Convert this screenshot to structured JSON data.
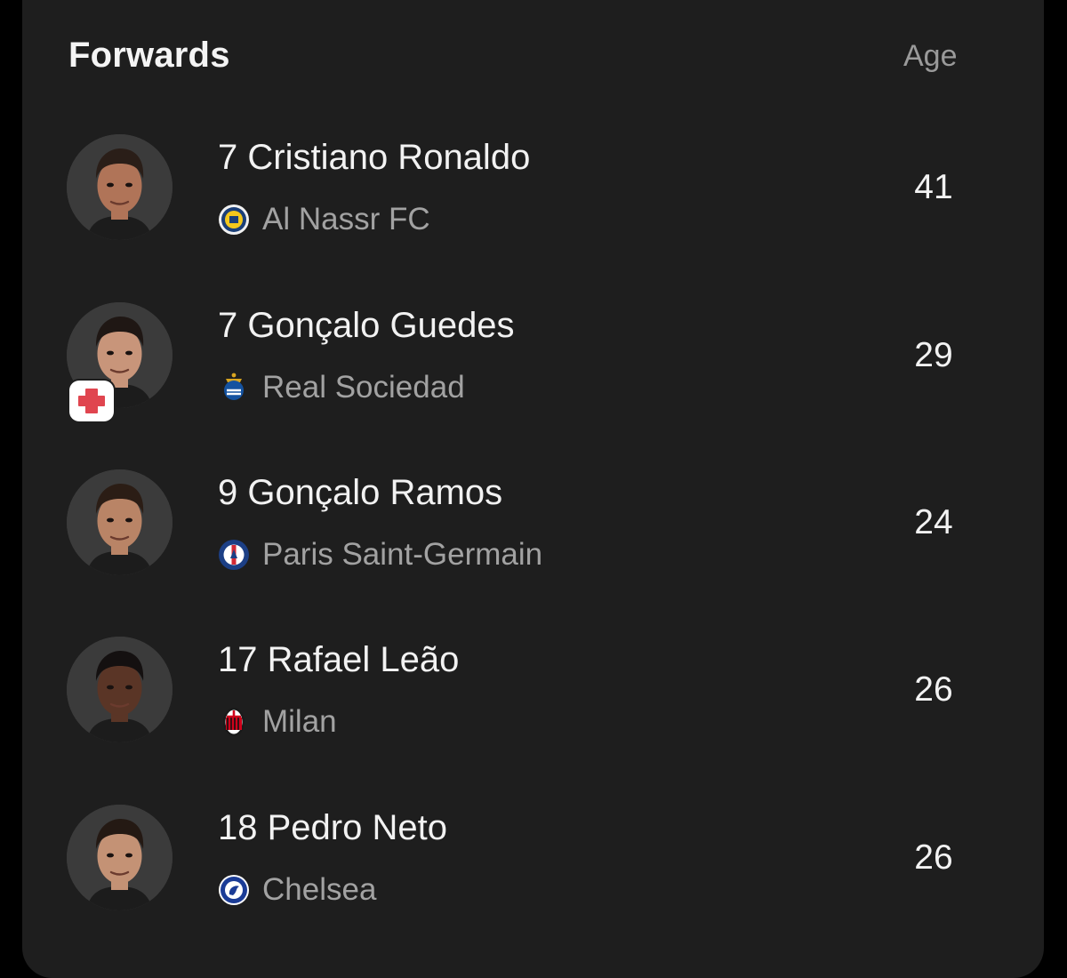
{
  "section": {
    "title": "Forwards",
    "age_header": "Age"
  },
  "players": [
    {
      "number_name": "7 Cristiano Ronaldo",
      "club": "Al Nassr FC",
      "age": "41",
      "club_logo": "al-nassr-logo",
      "injured": false,
      "skin": "#b07458",
      "hair": "#2a1e18"
    },
    {
      "number_name": "7 Gonçalo Guedes",
      "club": "Real Sociedad",
      "age": "29",
      "club_logo": "real-sociedad-logo",
      "injured": true,
      "skin": "#c8957a",
      "hair": "#1f1714"
    },
    {
      "number_name": "9 Gonçalo Ramos",
      "club": "Paris Saint-Germain",
      "age": "24",
      "club_logo": "psg-logo",
      "injured": false,
      "skin": "#b98466",
      "hair": "#2b1d15"
    },
    {
      "number_name": "17 Rafael Leão",
      "club": "Milan",
      "age": "26",
      "club_logo": "ac-milan-logo",
      "injured": false,
      "skin": "#5a3526",
      "hair": "#141010"
    },
    {
      "number_name": "18 Pedro Neto",
      "club": "Chelsea",
      "age": "26",
      "club_logo": "chelsea-logo",
      "injured": false,
      "skin": "#c49275",
      "hair": "#241913"
    }
  ],
  "colors": {
    "background": "#000000",
    "card": "#1e1e1e",
    "primary_text": "#f2f2f2",
    "secondary_text": "#a2a2a2",
    "injury_red": "#e0454f"
  }
}
